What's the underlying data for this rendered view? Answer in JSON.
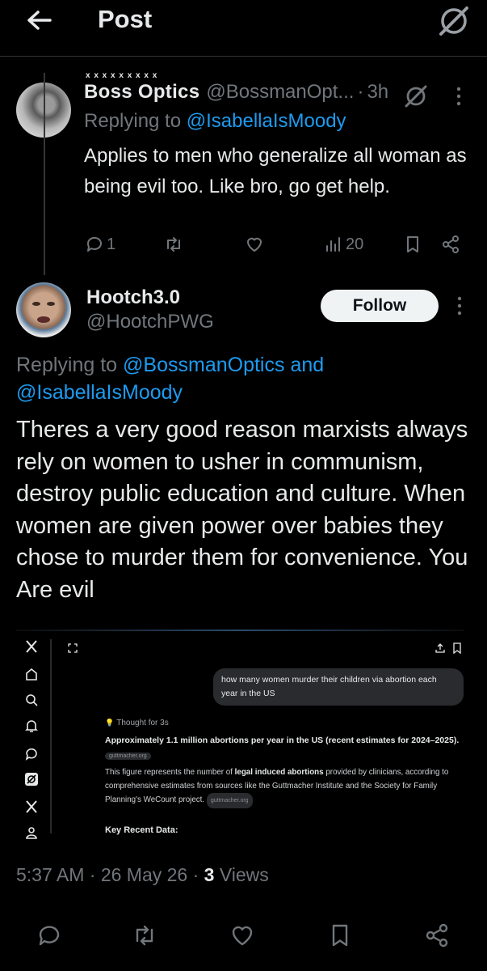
{
  "header": {
    "title": "Post"
  },
  "reply_post": {
    "display_name": "Boss Optics",
    "handle": "@BossmanOpt...",
    "separator": "·",
    "time": "3h",
    "replying_prefix": "Replying to",
    "replying_to": "@IsabellaIsMoody",
    "text": "Applies to men who generalize all woman as being evil too. Like bro, go get help.",
    "stats": {
      "replies": "1",
      "views": "20"
    }
  },
  "main_post": {
    "display_name": "Hootch3.0",
    "handle": "@HootchPWG",
    "follow_label": "Follow",
    "replying_prefix": "Replying to",
    "replying_to_1": "@BossmanOptics",
    "replying_and": "and",
    "replying_to_2": "@IsabellaIsMoody",
    "text": "Theres a very good reason marxists always rely on women to usher in communism, destroy public education and culture. When women are given power over babies they chose to murder them for convenience. You Are evil",
    "timestamp": "5:37 AM · 26 May 26 ·",
    "views_count": "3",
    "views_label": "Views"
  },
  "embedded_screenshot": {
    "query": "how many women murder their children via abortion each year in the US",
    "thought": "Thought for 3s",
    "headline": "Approximately 1.1 million abortions per year in the US (recent estimates for 2024–2025).",
    "source_chip": "guttmacher.org",
    "body_1": "This figure represents the number of",
    "body_bold": "legal induced abortions",
    "body_2": "provided by clinicians, according to comprehensive estimates from sources like the Guttmacher Institute and the Society for Family Planning's WeCount project.",
    "body_chip": "guttmacher.org",
    "key_heading": "Key Recent Data:"
  }
}
